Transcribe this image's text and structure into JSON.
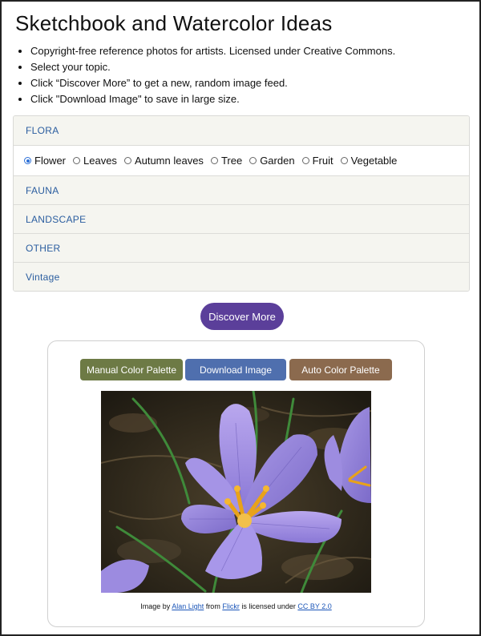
{
  "page": {
    "title": "Sketchbook and Watercolor Ideas",
    "instructions": [
      "Copyright-free reference photos for artists. Licensed under Creative Commons.",
      "Select your topic.",
      "Click “Discover More” to get a new, random image feed.",
      "Click \"Download Image\" to save in large size."
    ]
  },
  "accordion": {
    "sections": [
      {
        "label": "FLORA",
        "expanded": true
      },
      {
        "label": "FAUNA",
        "expanded": false
      },
      {
        "label": "LANDSCAPE",
        "expanded": false
      },
      {
        "label": "OTHER",
        "expanded": false
      },
      {
        "label": "Vintage",
        "expanded": false
      }
    ],
    "flora_options": [
      {
        "label": "Flower",
        "checked": true
      },
      {
        "label": "Leaves",
        "checked": false
      },
      {
        "label": "Autumn leaves",
        "checked": false
      },
      {
        "label": "Tree",
        "checked": false
      },
      {
        "label": "Garden",
        "checked": false
      },
      {
        "label": "Fruit",
        "checked": false
      },
      {
        "label": "Vegetable",
        "checked": false
      }
    ]
  },
  "actions": {
    "discover_label": "Discover More",
    "manual_palette_label": "Manual Color Palette",
    "download_label": "Download Image",
    "auto_palette_label": "Auto Color Palette"
  },
  "credit": {
    "prefix": "Image by ",
    "author": "Alan Light",
    "middle": " from ",
    "source": "Flickr",
    "licensed": " is licensed under ",
    "license": "CC BY 2.0"
  },
  "colors": {
    "accent_link": "#2a5d9f",
    "discover_button": "#5b3f9a",
    "manual_button": "#6d7a45",
    "download_button": "#4f6fae",
    "auto_button": "#8b6a4e",
    "radio_checked": "#2b6fd6"
  }
}
